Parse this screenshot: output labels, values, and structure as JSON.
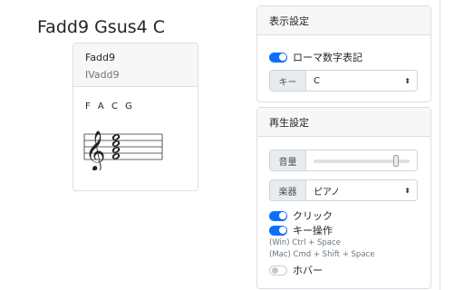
{
  "progression": "Fadd9 Gsus4 C",
  "chord_card": {
    "name": "Fadd9",
    "roman": "IVadd9",
    "notes": "F A C G"
  },
  "display_settings": {
    "title": "表示設定",
    "roman_toggle": {
      "label": "ローマ数字表記",
      "checked": true
    },
    "key": {
      "label": "キー",
      "value": "C"
    }
  },
  "play_settings": {
    "title": "再生設定",
    "volume": {
      "label": "音量",
      "level": 0.86
    },
    "instrument": {
      "label": "楽器",
      "value": "ピアノ"
    },
    "click_toggle": {
      "label": "クリック",
      "checked": true
    },
    "key_op_toggle": {
      "label": "キー操作",
      "checked": true
    },
    "hint_win": "(Win) Ctrl + Space",
    "hint_mac": "(Mac) Cmd + Shift + Space",
    "hover_toggle": {
      "label": "ホバー",
      "checked": false
    }
  },
  "accent_color": "#0d6efd"
}
